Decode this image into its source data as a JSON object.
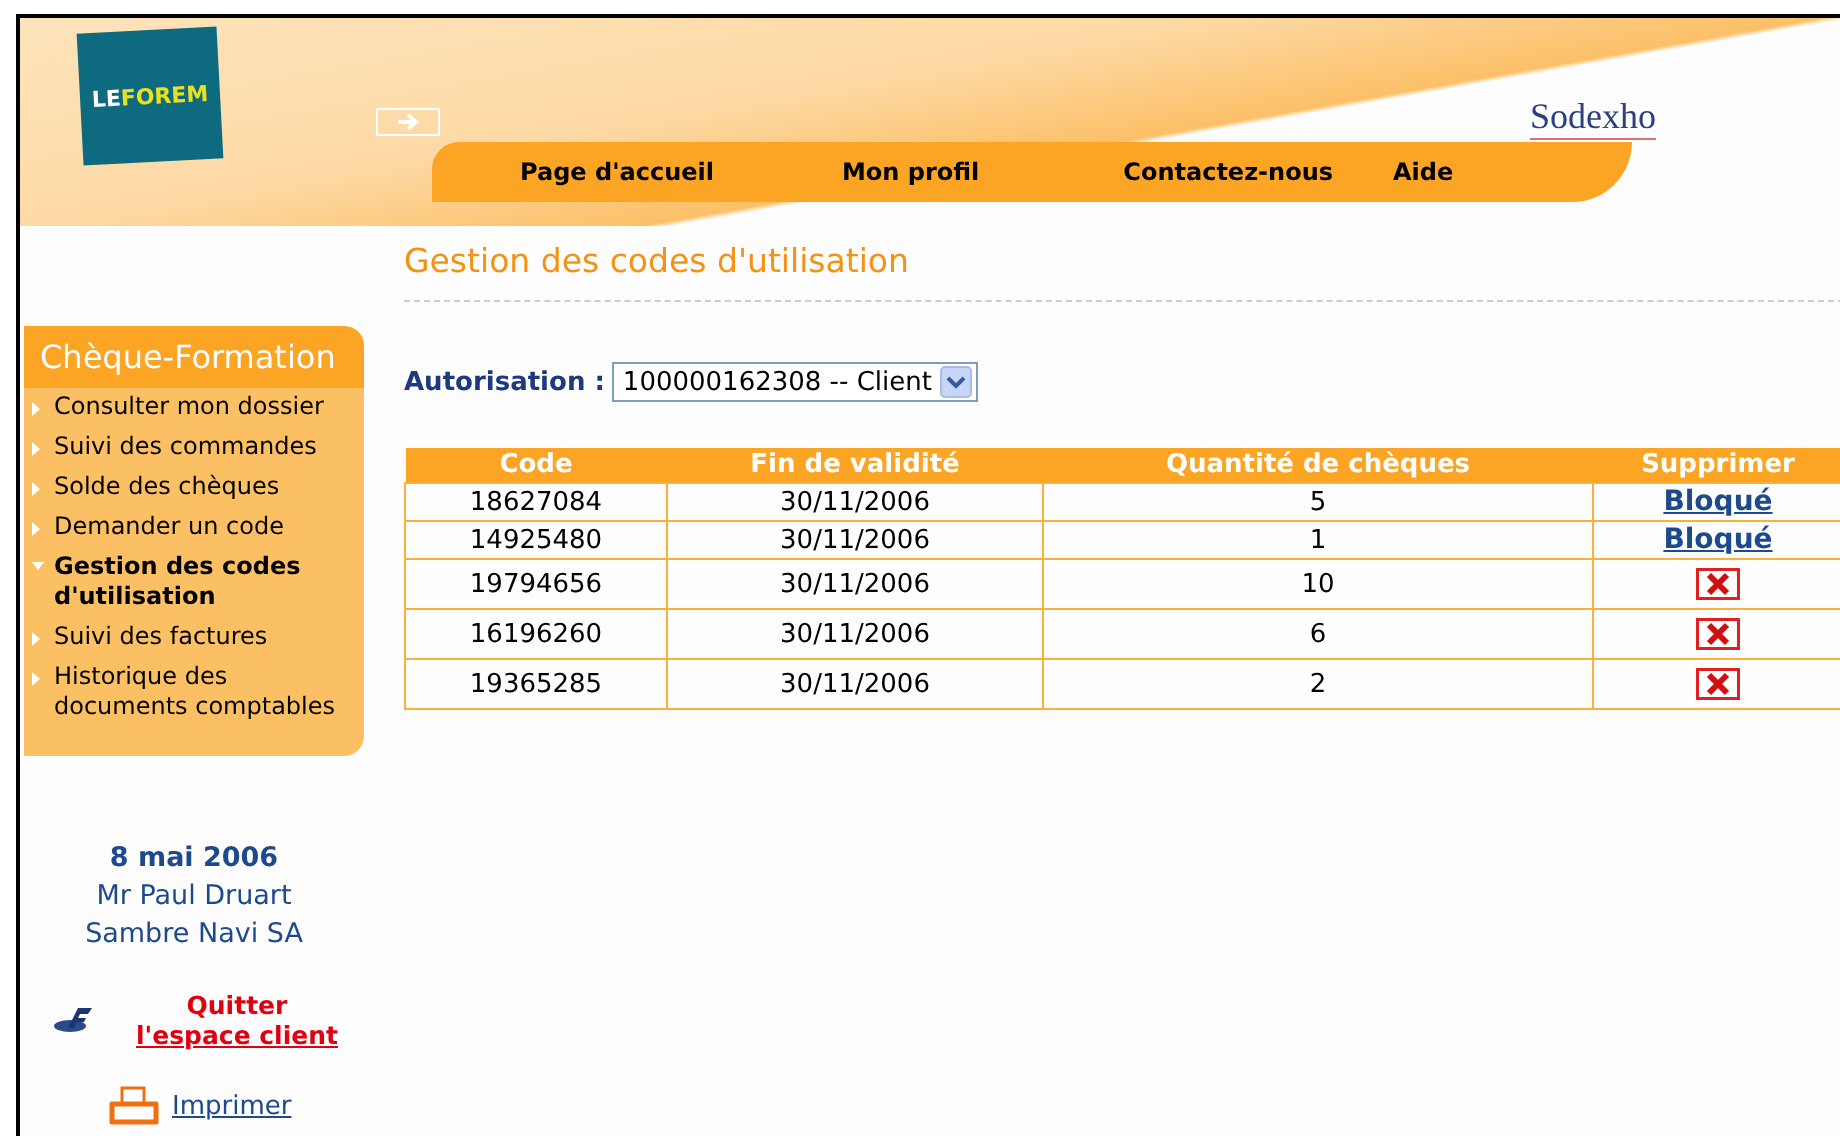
{
  "header": {
    "logo": {
      "part_1": "LE",
      "part_2": "FOREM"
    },
    "partner_logo": "Sodexho",
    "nav": [
      "Page d'accueil",
      "Mon profil",
      "Contactez-nous",
      "Aide"
    ]
  },
  "sidebar": {
    "title": "Chèque-Formation",
    "items": [
      {
        "label": "Consulter mon dossier",
        "selected": false
      },
      {
        "label": "Suivi des commandes",
        "selected": false
      },
      {
        "label": "Solde des chèques",
        "selected": false
      },
      {
        "label": "Demander un code",
        "selected": false
      },
      {
        "label": "Gestion des codes d'utilisation",
        "selected": true
      },
      {
        "label": "Suivi des factures",
        "selected": false
      },
      {
        "label": "Historique des documents comptables",
        "selected": false
      }
    ],
    "date": "8 mai 2006",
    "user": "Mr Paul Druart",
    "company": "Sambre Navi SA",
    "logout": {
      "line_1": "Quitter",
      "line_2": "l'espace client"
    },
    "print": "Imprimer"
  },
  "page_title": "Gestion des codes d'utilisation",
  "authorization": {
    "label": "Autorisation :",
    "value": "100000162308 -- Client"
  },
  "table": {
    "columns": [
      "Code",
      "Fin de validité",
      "Quantité de chèques",
      "Supprimer"
    ],
    "rows": [
      {
        "code": "18627084",
        "end": "30/11/2006",
        "quantity": "5",
        "action": {
          "kind": "link",
          "text": "Bloqué"
        }
      },
      {
        "code": "14925480",
        "end": "30/11/2006",
        "quantity": "1",
        "action": {
          "kind": "link",
          "text": "Bloqué"
        }
      },
      {
        "code": "19794656",
        "end": "30/11/2006",
        "quantity": "10",
        "action": {
          "kind": "delete"
        }
      },
      {
        "code": "16196260",
        "end": "30/11/2006",
        "quantity": "6",
        "action": {
          "kind": "delete"
        }
      },
      {
        "code": "19365285",
        "end": "30/11/2006",
        "quantity": "2",
        "action": {
          "kind": "delete"
        }
      }
    ]
  }
}
